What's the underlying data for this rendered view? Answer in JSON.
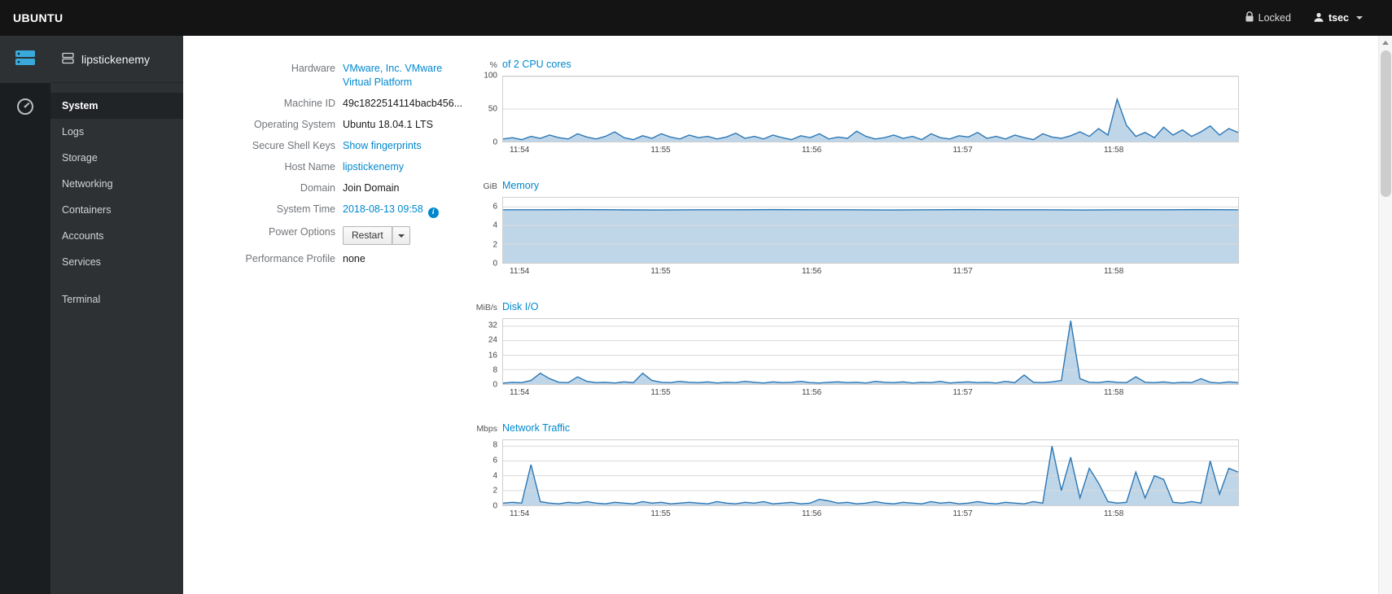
{
  "colors": {
    "accent_blue": "#0088ce",
    "chart_line": "#2b77b5",
    "chart_fill": "rgba(43,119,181,0.30)",
    "topbar_bg": "#141414",
    "sidebar_bg": "#2d3134"
  },
  "topbar": {
    "brand": "UBUNTU",
    "locked_label": "Locked",
    "user_label": "tsec"
  },
  "sidebar": {
    "host": "lipstickenemy",
    "items": [
      {
        "label": "System",
        "active": true
      },
      {
        "label": "Logs"
      },
      {
        "label": "Storage"
      },
      {
        "label": "Networking"
      },
      {
        "label": "Containers"
      },
      {
        "label": "Accounts"
      },
      {
        "label": "Services"
      },
      {
        "label": "Terminal",
        "separated": true
      }
    ]
  },
  "system": {
    "rows": [
      {
        "label": "Hardware",
        "value": "VMware, Inc. VMware Virtual Platform",
        "type": "link"
      },
      {
        "label": "Machine ID",
        "value": "49c1822514114bacb456...",
        "type": "text"
      },
      {
        "label": "Operating System",
        "value": "Ubuntu 18.04.1 LTS",
        "type": "text"
      },
      {
        "label": "Secure Shell Keys",
        "value": "Show fingerprints",
        "type": "link"
      },
      {
        "label": "Host Name",
        "value": "lipstickenemy",
        "type": "link"
      },
      {
        "label": "Domain",
        "value": "Join Domain",
        "type": "text"
      },
      {
        "label": "System Time",
        "value": "2018-08-13 09:58",
        "type": "link-info"
      },
      {
        "label": "Power Options",
        "value": "Restart",
        "type": "split-button"
      },
      {
        "label": "Performance Profile",
        "value": "none",
        "type": "text"
      }
    ]
  },
  "charts": [
    {
      "type": "area",
      "unit": "%",
      "title": "of 2 CPU cores",
      "ymax": 100,
      "yticks": [
        0,
        50,
        100
      ],
      "xticks": [
        "11:54",
        "11:55",
        "11:56",
        "11:57",
        "11:58"
      ],
      "values": [
        4,
        6,
        3,
        8,
        5,
        10,
        6,
        4,
        12,
        7,
        4,
        8,
        15,
        6,
        3,
        9,
        5,
        12,
        7,
        4,
        10,
        6,
        8,
        4,
        7,
        13,
        5,
        8,
        4,
        10,
        6,
        3,
        9,
        6,
        12,
        4,
        7,
        5,
        16,
        8,
        4,
        6,
        10,
        5,
        8,
        3,
        12,
        6,
        4,
        9,
        7,
        14,
        5,
        8,
        4,
        10,
        6,
        3,
        12,
        7,
        5,
        9,
        15,
        8,
        20,
        10,
        65,
        25,
        8,
        14,
        6,
        22,
        10,
        18,
        8,
        15,
        24,
        10,
        20,
        14
      ]
    },
    {
      "type": "area",
      "unit": "GiB",
      "title": "Memory",
      "ymax": 7,
      "yticks": [
        0,
        2,
        4,
        6
      ],
      "xticks": [
        "11:54",
        "11:55",
        "11:56",
        "11:57",
        "11:58"
      ],
      "values": [
        5.7,
        5.7,
        5.72,
        5.7,
        5.68,
        5.7,
        5.7,
        5.72,
        5.7,
        5.7,
        5.68,
        5.7,
        5.72,
        5.7,
        5.7,
        5.68,
        5.7,
        5.7,
        5.72,
        5.7
      ]
    },
    {
      "type": "area",
      "unit": "MiB/s",
      "title": "Disk I/O",
      "ymax": 36,
      "yticks": [
        0,
        8,
        16,
        24,
        32
      ],
      "xticks": [
        "11:54",
        "11:55",
        "11:56",
        "11:57",
        "11:58"
      ],
      "values": [
        0.5,
        1,
        0.8,
        2,
        6,
        3,
        1,
        0.8,
        4,
        1.5,
        0.8,
        1,
        0.6,
        1.2,
        0.8,
        6,
        2,
        1,
        0.8,
        1.5,
        1,
        0.8,
        1.2,
        0.6,
        1,
        0.8,
        1.5,
        1,
        0.6,
        1.2,
        0.8,
        1,
        1.5,
        0.8,
        0.6,
        1,
        1.2,
        0.8,
        1,
        0.6,
        1.5,
        1,
        0.8,
        1.2,
        0.6,
        1,
        0.8,
        1.5,
        0.6,
        1,
        1.2,
        0.8,
        1,
        0.6,
        1.5,
        0.8,
        5,
        1,
        0.8,
        1.2,
        2,
        35,
        3,
        1,
        0.8,
        1.5,
        1,
        0.8,
        4,
        1,
        0.8,
        1.2,
        0.6,
        1,
        0.8,
        3,
        1,
        0.6,
        1.2,
        0.8
      ]
    },
    {
      "type": "area",
      "unit": "Mbps",
      "title": "Network Traffic",
      "ymax": 8.8,
      "yticks": [
        0,
        2,
        4,
        6,
        8
      ],
      "xticks": [
        "11:54",
        "11:55",
        "11:56",
        "11:57",
        "11:58"
      ],
      "values": [
        0.3,
        0.4,
        0.3,
        5.5,
        0.5,
        0.3,
        0.2,
        0.4,
        0.3,
        0.5,
        0.3,
        0.2,
        0.4,
        0.3,
        0.2,
        0.5,
        0.3,
        0.4,
        0.2,
        0.3,
        0.4,
        0.3,
        0.2,
        0.5,
        0.3,
        0.2,
        0.4,
        0.3,
        0.5,
        0.2,
        0.3,
        0.4,
        0.2,
        0.3,
        0.8,
        0.6,
        0.3,
        0.4,
        0.2,
        0.3,
        0.5,
        0.3,
        0.2,
        0.4,
        0.3,
        0.2,
        0.5,
        0.3,
        0.4,
        0.2,
        0.3,
        0.5,
        0.3,
        0.2,
        0.4,
        0.3,
        0.2,
        0.5,
        0.3,
        8,
        2,
        6.5,
        1,
        5,
        3,
        0.5,
        0.3,
        0.4,
        4.5,
        1,
        4,
        3.5,
        0.4,
        0.3,
        0.5,
        0.3,
        6,
        1.5,
        5,
        4.5
      ]
    }
  ]
}
